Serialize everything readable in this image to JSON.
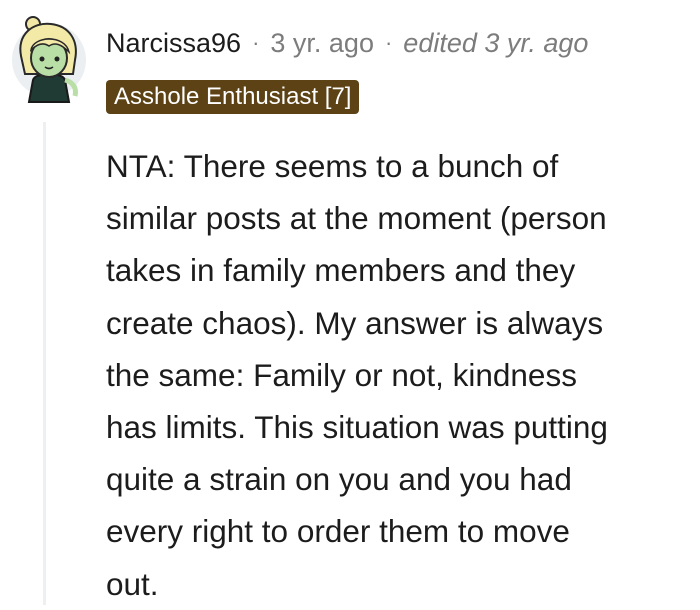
{
  "comment": {
    "author": "Narcissa96",
    "separator": "·",
    "timestamp": "3 yr. ago",
    "edited": "edited 3 yr. ago",
    "flair": "Asshole Enthusiast [7]",
    "flair_color": "#5c4214",
    "avatar_icon": "avatar-icon",
    "body_lines": [
      "NTA: There seems to a bunch of",
      "similar posts at the moment (person",
      "takes in family members and they",
      "create chaos). My answer is always",
      "the same: Family or not, kindness",
      "has limits. This situation was putting",
      "quite a strain on you and you had",
      "every right to order them to move",
      "out."
    ]
  }
}
